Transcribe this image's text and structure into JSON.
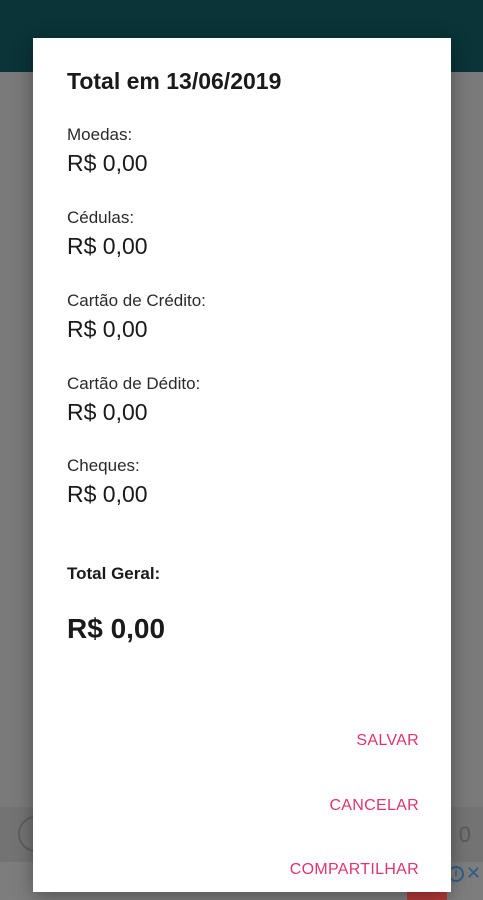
{
  "dialog": {
    "title": "Total em 13/06/2019",
    "entries": [
      {
        "label": "Moedas:",
        "value": "R$ 0,00"
      },
      {
        "label": "Cédulas:",
        "value": "R$ 0,00"
      },
      {
        "label": "Cartão de Crédito:",
        "value": "R$ 0,00"
      },
      {
        "label": "Cartão de Dédito:",
        "value": "R$ 0,00"
      },
      {
        "label": "Cheques:",
        "value": "R$ 0,00"
      }
    ],
    "total_label": "Total Geral:",
    "total_value": "R$ 0,00",
    "actions": {
      "save": "SALVAR",
      "cancel": "CANCELAR",
      "share": "COMPARTILHAR"
    }
  },
  "colors": {
    "accent": "#e0356c",
    "app_bar": "#0a3438",
    "scrim": "#7a7a7a"
  },
  "background": {
    "bottom_right_text": "0"
  },
  "ad": {
    "info_icon": "i",
    "close_icon": "✕"
  }
}
